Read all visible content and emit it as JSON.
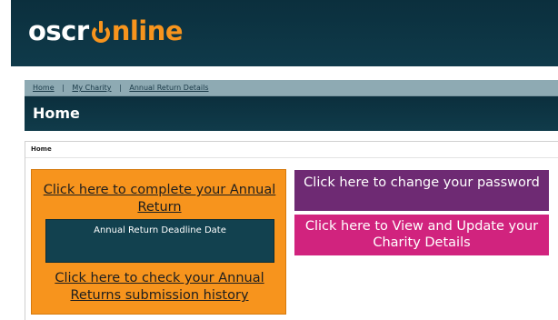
{
  "logo": {
    "part1": "oscr",
    "part2": "nline"
  },
  "breadcrumb": {
    "home": "Home",
    "sep1": "|",
    "my_charity": "My Charity",
    "sep2": "|",
    "annual_return": "Annual Return Details"
  },
  "page_title": "Home",
  "content_crumb": "Home",
  "orange_panel": {
    "complete_link": "Click here to complete your Annual Return",
    "deadline_label": "Annual Return Deadline Date",
    "history_link": "Click here to check your Annual Returns submission history"
  },
  "buttons": {
    "change_password": "Click here to change your password",
    "view_update": "Click here to View and Update your Charity Details"
  },
  "colors": {
    "header": "#0b2f3d",
    "orange": "#f7941d",
    "purple": "#6e2a73",
    "magenta": "#d1237e",
    "deadline_box": "#12414f",
    "breadcrumb_bg": "#8eaab3"
  }
}
